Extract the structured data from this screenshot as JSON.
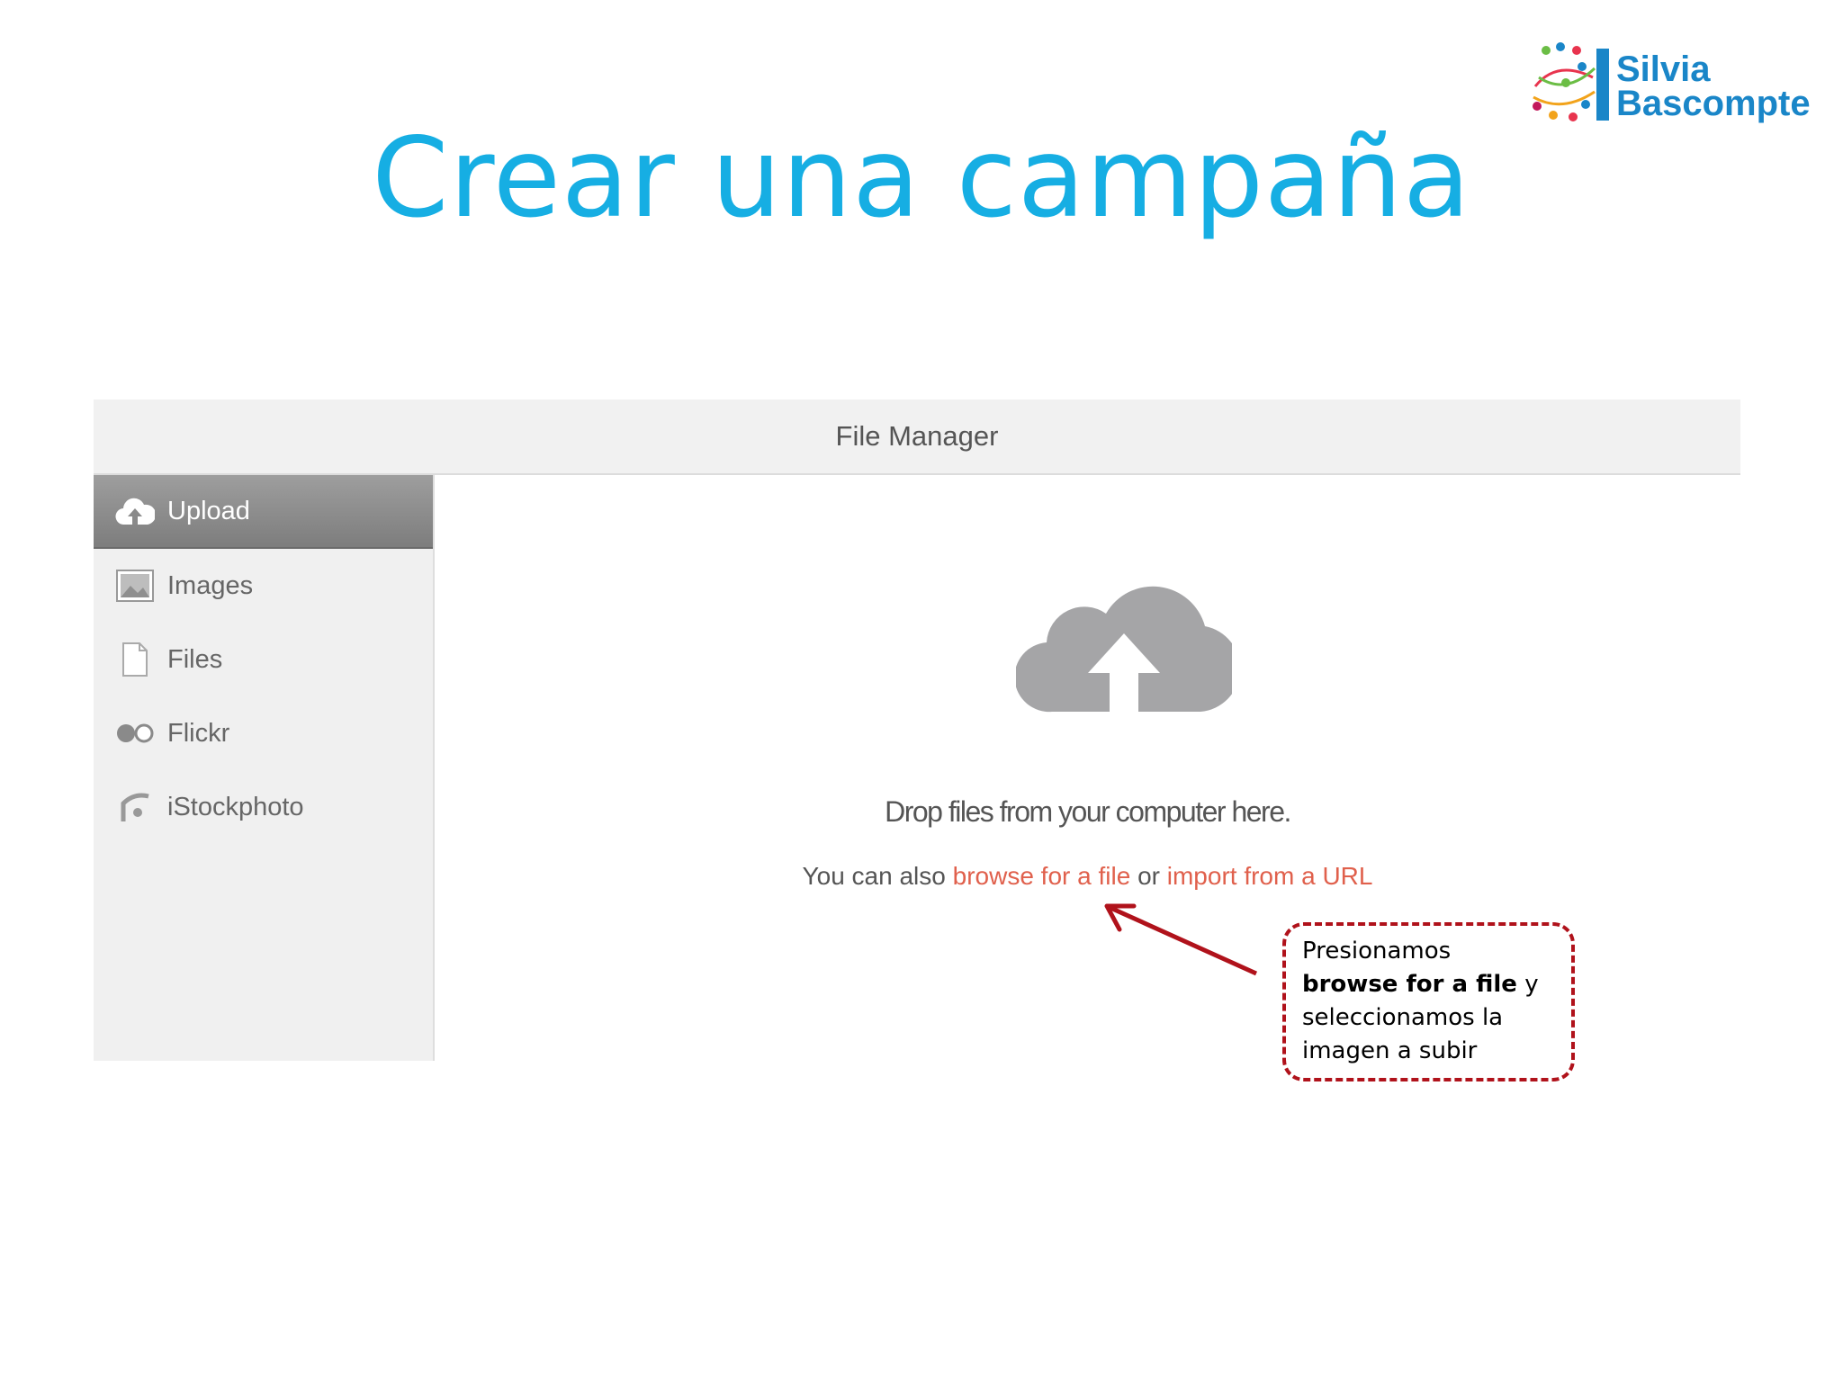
{
  "slide": {
    "title": "Crear una campaña",
    "logo": {
      "line1": "Silvia",
      "line2": "Bascompte"
    }
  },
  "file_manager": {
    "header_title": "File Manager",
    "sidebar": {
      "items": [
        {
          "label": "Upload",
          "icon": "cloud-upload-icon",
          "active": true
        },
        {
          "label": "Images",
          "icon": "image-icon",
          "active": false
        },
        {
          "label": "Files",
          "icon": "file-icon",
          "active": false
        },
        {
          "label": "Flickr",
          "icon": "flickr-icon",
          "active": false
        },
        {
          "label": "iStockphoto",
          "icon": "istockphoto-icon",
          "active": false
        }
      ]
    },
    "main": {
      "drop_text": "Drop files from your computer here.",
      "browse_prefix": "You can also",
      "browse_link": "browse for a file",
      "browse_or": "or",
      "import_link": "import from a URL"
    }
  },
  "callout": {
    "text_before": "Presionamos",
    "bold": "browse for a file",
    "text_after": "y seleccionamos la imagen a subir"
  },
  "colors": {
    "title": "#16aee3",
    "link": "#e0604c",
    "callout_border": "#b0121b",
    "sidebar_active": "#8a8a8a"
  }
}
